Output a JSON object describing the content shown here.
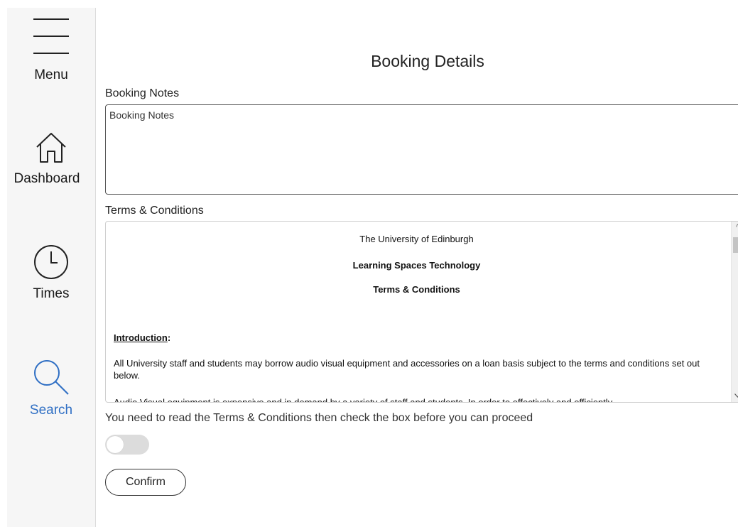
{
  "sidebar": {
    "items": [
      {
        "label": "Menu",
        "icon": "hamburger-menu-icon",
        "active": false
      },
      {
        "label": "Dashboard",
        "icon": "home-icon",
        "active": false
      },
      {
        "label": "Times",
        "icon": "clock-icon",
        "active": false
      },
      {
        "label": "Search",
        "icon": "search-icon",
        "active": true
      }
    ]
  },
  "main": {
    "title": "Booking Details",
    "notes": {
      "label": "Booking Notes",
      "placeholder": "Booking Notes"
    },
    "terms": {
      "label": "Terms & Conditions",
      "org": "The University of Edinburgh",
      "dept": "Learning Spaces Technology",
      "title": "Terms & Conditions",
      "intro_heading": "Introduction",
      "intro_colon": ":",
      "para1": "All University staff and students may borrow audio visual equipment and accessories on a loan basis subject to the terms and conditions set out below.",
      "para2": "Audio Visual equipment is expensive and in demand by a variety of staff and students. In order to effectively and efficiently"
    },
    "notice": "You need to read the Terms & Conditions then check the box before you can proceed",
    "agree_toggle": {
      "checked": false
    },
    "confirm_label": "Confirm"
  },
  "colors": {
    "active_nav": "#2f6fc4",
    "sidebar_bg": "#f6f6f6",
    "toggle_off": "#dcdcdc"
  }
}
